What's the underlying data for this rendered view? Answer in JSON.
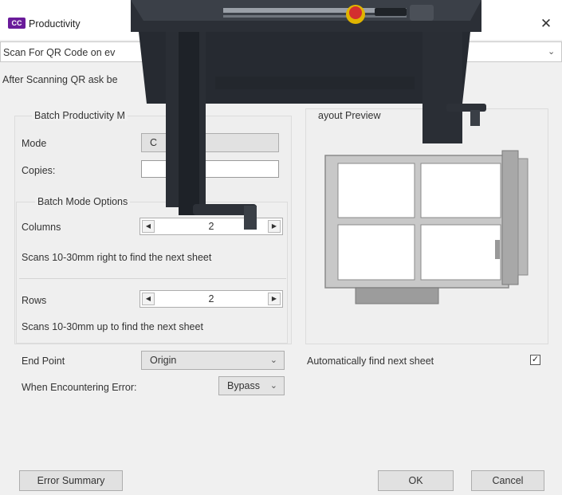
{
  "window": {
    "icon_text": "CC",
    "title": "Productivity",
    "close_glyph": "✕"
  },
  "qr_scan": {
    "label": "Scan For QR Code on ev",
    "chevron": "⌄"
  },
  "qr_ask": {
    "label": "After Scanning QR ask be"
  },
  "batch": {
    "group_title": "Batch Productivity M",
    "mode_label": "Mode",
    "mode_value": "C",
    "copies_label": "Copies:",
    "options_title": "Batch Mode Options",
    "columns_label": "Columns",
    "columns_value": "2",
    "columns_hint": "Scans 10-30mm right to find the next sheet",
    "rows_label": "Rows",
    "rows_value": "2",
    "rows_hint": "Scans 10-30mm up to find the next sheet",
    "arrow_left": "◀",
    "arrow_right": "▶"
  },
  "layout_preview": {
    "title": "ayout Preview",
    "grid_columns": 2,
    "grid_rows": 2
  },
  "end_point": {
    "label": "End Point",
    "value": "Origin",
    "chevron": "⌄"
  },
  "auto_find": {
    "label": "Automatically find next sheet",
    "checked": true,
    "mark": "✓"
  },
  "error": {
    "label": "When Encountering Error:",
    "value": "Bypass",
    "chevron": "⌄"
  },
  "buttons": {
    "error_summary": "Error Summary",
    "ok": "OK",
    "cancel": "Cancel"
  },
  "colors": {
    "app_icon": "#6a1b9a",
    "plotter_body": "#2b2f36",
    "emergency_button": "#d32f2f"
  }
}
